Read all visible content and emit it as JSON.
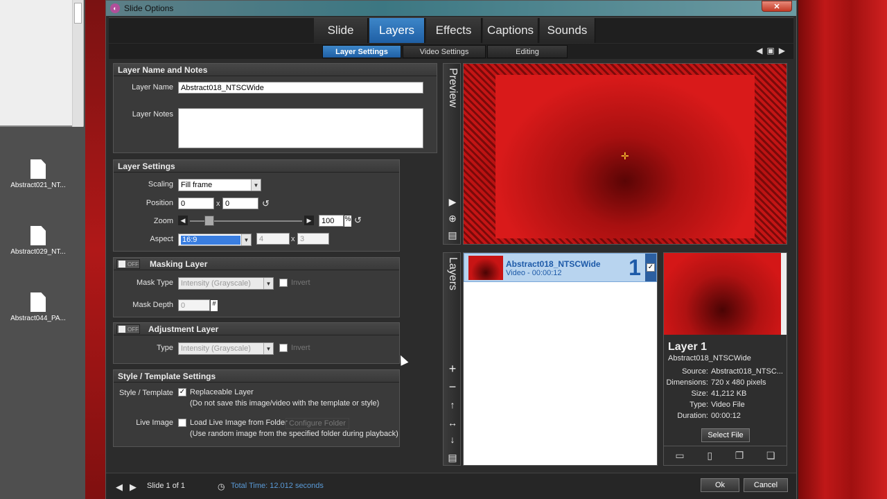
{
  "desktop": {
    "files": [
      {
        "label": "Abstract021_NT..."
      },
      {
        "label": "Abstract029_NT..."
      },
      {
        "label": "Abstract044_PA..."
      }
    ]
  },
  "window": {
    "title": "Slide Options",
    "close_label": "✕"
  },
  "tabs": [
    "Slide",
    "Layers",
    "Effects",
    "Captions",
    "Sounds"
  ],
  "active_tab": "Layers",
  "subtabs": [
    "Layer Settings",
    "Video Settings",
    "Editing"
  ],
  "name_notes": {
    "header": "Layer Name and Notes",
    "layer_name_label": "Layer Name",
    "layer_name_value": "Abstract018_NTSCWide",
    "layer_notes_label": "Layer Notes",
    "layer_notes_value": ""
  },
  "layer_settings": {
    "header": "Layer Settings",
    "scaling_label": "Scaling",
    "scaling_value": "Fill frame",
    "position_label": "Position",
    "position_x": "0",
    "position_sep": "x",
    "position_y": "0",
    "zoom_label": "Zoom",
    "zoom_value": "100",
    "zoom_unit": "%",
    "zoom_level": 0.14,
    "aspect_label": "Aspect",
    "aspect_value": "16:9",
    "aspect_w": "4",
    "aspect_sep": "x",
    "aspect_h": "3"
  },
  "masking": {
    "toggle": "OFF",
    "header": "Masking Layer",
    "mask_type_label": "Mask Type",
    "mask_type_value": "Intensity (Grayscale)",
    "invert_label": "Invert",
    "mask_depth_label": "Mask Depth",
    "mask_depth_value": "0",
    "mask_depth_unit": "#"
  },
  "adjustment": {
    "toggle": "OFF",
    "header": "Adjustment Layer",
    "type_label": "Type",
    "type_value": "Intensity (Grayscale)",
    "invert_label": "Invert"
  },
  "style_template": {
    "header": "Style / Template Settings",
    "style_label": "Style / Template",
    "replaceable_label": "Replaceable Layer",
    "replaceable_note": "(Do not save this image/video with the template or style)",
    "live_label": "Live Image",
    "live_checkbox_label": "Load Live Image from Folder",
    "configure_label": "Configure Folder",
    "live_note": "(Use random image from the specified folder during playback)"
  },
  "preview": {
    "label": "Preview"
  },
  "layers_panel": {
    "label": "Layers",
    "items": [
      {
        "name": "Abstract018_NTSCWide",
        "detail": "Video - 00:00:12",
        "number": "1"
      }
    ]
  },
  "layer_info": {
    "title": "Layer 1",
    "subtitle": "Abstract018_NTSCWide",
    "source_label": "Source:",
    "source_value": "Abstract018_NTSC...",
    "dimensions_label": "Dimensions:",
    "dimensions_value": "720 x 480 pixels",
    "size_label": "Size:",
    "size_value": "41,212 KB",
    "type_label": "Type:",
    "type_value": "Video File",
    "duration_label": "Duration:",
    "duration_value": "00:00:12",
    "select_file": "Select File"
  },
  "footer": {
    "slide_label": "Slide 1 of 1",
    "total_time": "Total Time: 12.012 seconds",
    "ok": "Ok",
    "cancel": "Cancel"
  }
}
